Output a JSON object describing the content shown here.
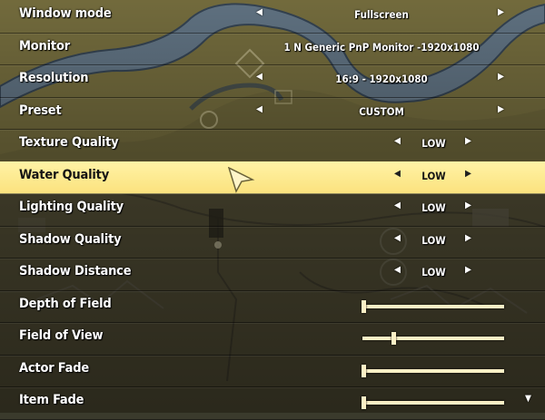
{
  "settings": [
    {
      "label": "Window mode",
      "kind": "select",
      "layout": "wide",
      "value": "Fullscreen"
    },
    {
      "label": "Monitor",
      "kind": "text",
      "layout": "wide",
      "value": "1 N Generic PnP Monitor -1920x1080"
    },
    {
      "label": "Resolution",
      "kind": "select",
      "layout": "wide",
      "value": "16:9 - 1920x1080"
    },
    {
      "label": "Preset",
      "kind": "select",
      "layout": "wide",
      "value": "CUSTOM"
    },
    {
      "label": "Texture Quality",
      "kind": "select",
      "layout": "narrow",
      "value": "LOW"
    },
    {
      "label": "Water Quality",
      "kind": "select",
      "layout": "narrow",
      "value": "LOW",
      "selected": true
    },
    {
      "label": "Lighting Quality",
      "kind": "select",
      "layout": "narrow",
      "value": "LOW"
    },
    {
      "label": "Shadow Quality",
      "kind": "select",
      "layout": "narrow",
      "value": "LOW"
    },
    {
      "label": "Shadow Distance",
      "kind": "select",
      "layout": "narrow",
      "value": "LOW"
    },
    {
      "label": "Depth of Field",
      "kind": "slider",
      "level": 0.0
    },
    {
      "label": "Field of View",
      "kind": "slider",
      "level": 0.21
    },
    {
      "label": "Actor Fade",
      "kind": "slider",
      "level": 0.0
    },
    {
      "label": "Item Fade",
      "kind": "slider",
      "level": 0.0
    }
  ],
  "icons": {
    "arrow_left": "◀",
    "arrow_right": "▶",
    "scroll_down": "▼"
  },
  "colors": {
    "highlight": "#fbe27e",
    "slider": "#fbf0c6",
    "text": "#ffffff"
  }
}
